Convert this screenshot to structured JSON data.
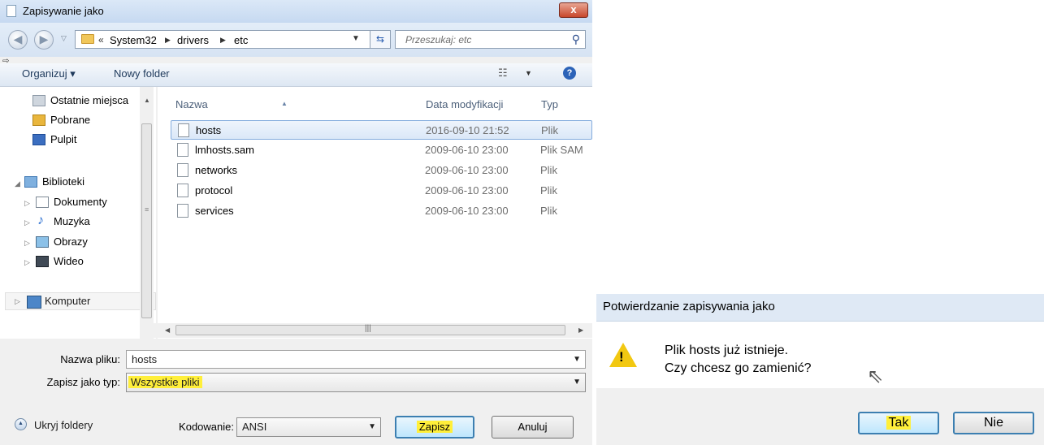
{
  "save_dialog": {
    "title": "Zapisywanie jako",
    "close_label": "x",
    "address": {
      "history": "«",
      "crumbs": [
        "System32",
        "drivers",
        "etc"
      ]
    },
    "search": {
      "placeholder": "Przeszukaj: etc"
    },
    "toolbar": {
      "organize": "Organizuj ▾",
      "new_folder": "Nowy folder"
    },
    "nav": {
      "recent": "Ostatnie miejsca",
      "downloads": "Pobrane",
      "desktop": "Pulpit",
      "libraries": "Biblioteki",
      "documents": "Dokumenty",
      "music": "Muzyka",
      "pictures": "Obrazy",
      "video": "Wideo",
      "computer": "Komputer"
    },
    "columns": {
      "name": "Nazwa",
      "date": "Data modyfikacji",
      "type": "Typ"
    },
    "files": [
      {
        "name": "hosts",
        "date": "2016-09-10 21:52",
        "type": "Plik"
      },
      {
        "name": "lmhosts.sam",
        "date": "2009-06-10 23:00",
        "type": "Plik SAM"
      },
      {
        "name": "networks",
        "date": "2009-06-10 23:00",
        "type": "Plik"
      },
      {
        "name": "protocol",
        "date": "2009-06-10 23:00",
        "type": "Plik"
      },
      {
        "name": "services",
        "date": "2009-06-10 23:00",
        "type": "Plik"
      }
    ],
    "form": {
      "filename_label": "Nazwa pliku:",
      "filename_value": "hosts",
      "type_label": "Zapisz jako typ:",
      "type_value": "Wszystkie pliki",
      "encoding_label": "Kodowanie:",
      "encoding_value": "ANSI"
    },
    "hide_folders": "Ukryj foldery",
    "buttons": {
      "save": "Zapisz",
      "cancel": "Anuluj"
    }
  },
  "confirm_dialog": {
    "title": "Potwierdzanie zapisywania jako",
    "message_line1": "Plik hosts już istnieje.",
    "message_line2": "Czy chcesz go zamienić?",
    "yes": "Tak",
    "no": "Nie"
  },
  "colors": {
    "highlight": "#ffef3a",
    "selection": "#dbe8f8",
    "accent": "#3c7fb1"
  }
}
